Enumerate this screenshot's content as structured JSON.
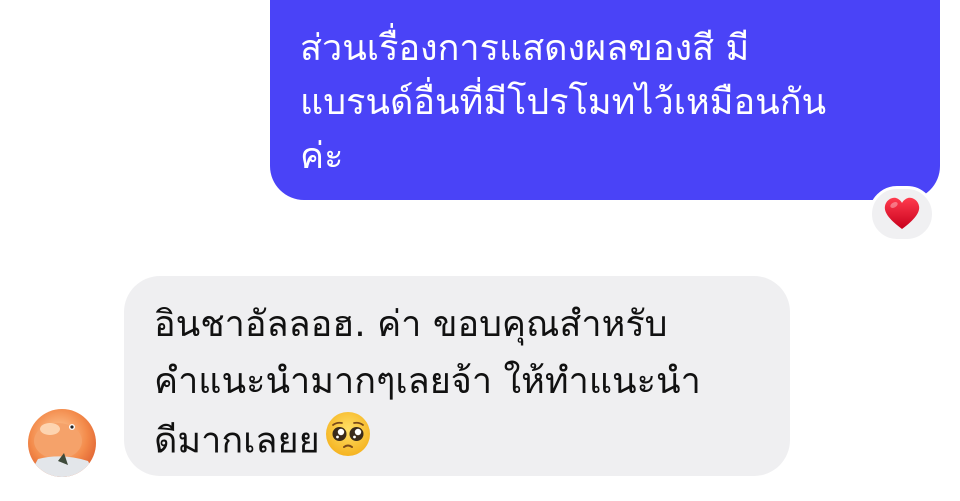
{
  "outgoing_message": {
    "lines": [
      "ส่วนเรื่องการแสดงผลของสี มี",
      "แบรนด์อื่นที่มีโปรโมทไว้เหมือนกัน",
      "ค่ะ"
    ]
  },
  "reaction": {
    "icon": "red-heart-icon",
    "color": "#e8112d"
  },
  "incoming_message": {
    "lines": [
      "อินชาอัลลอฮ. ค่า  ขอบคุณสำหรับ",
      "คำแนะนำมากๆเลยจ้า ให้ทำแนะนำ",
      "ดีมากเลยย"
    ],
    "emoji": "pleading-face-icon"
  },
  "sender_avatar": {
    "icon": "avatar"
  },
  "colors": {
    "outgoing_bubble": "#4a43f7",
    "incoming_bubble": "#efeff1",
    "outgoing_text": "#ffffff",
    "incoming_text": "#111111"
  }
}
